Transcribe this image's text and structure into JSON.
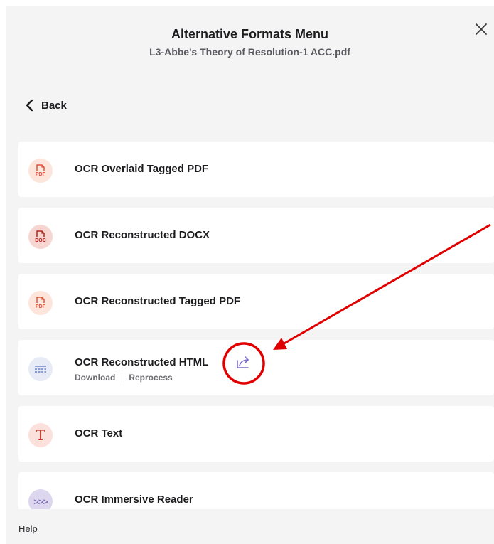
{
  "dialog": {
    "title": "Alternative Formats Menu",
    "subtitle": "L3-Abbe's Theory of Resolution-1 ACC.pdf",
    "close_icon": "close-icon",
    "back_label": "Back"
  },
  "formats": [
    {
      "label": "OCR Overlaid Tagged PDF",
      "icon": "pdf-file-icon",
      "icon_tag": "PDF",
      "icon_color": "#e2553a",
      "icon_bg": "#fde5dc"
    },
    {
      "label": "OCR Reconstructed DOCX",
      "icon": "doc-file-icon",
      "icon_tag": "DOC",
      "icon_color": "#b3261e",
      "icon_bg": "#f7d6d2"
    },
    {
      "label": "OCR Reconstructed Tagged PDF",
      "icon": "pdf-file-icon",
      "icon_tag": "PDF",
      "icon_color": "#e2553a",
      "icon_bg": "#fde5dc"
    },
    {
      "label": "OCR Reconstructed HTML",
      "icon": "html-lines-icon",
      "icon_color": "#6b7fc7",
      "icon_bg": "#e7ebf6",
      "actions": {
        "download": "Download",
        "reprocess": "Reprocess"
      }
    },
    {
      "label": "OCR Text",
      "icon": "text-T-icon",
      "icon_glyph": "T",
      "icon_color": "#c0392b",
      "icon_bg": "#fbe0dc"
    },
    {
      "label": "OCR Immersive Reader",
      "icon": "chevrons-right-icon",
      "icon_glyph": ">>>",
      "icon_color": "#6b5aa8",
      "icon_bg": "#dcd6ef"
    }
  ],
  "footer": {
    "help_label": "Help"
  },
  "colors": {
    "panel_bg": "#f4f4f5",
    "annotation_red": "#e00000",
    "share_icon": "#7b6ad1"
  }
}
